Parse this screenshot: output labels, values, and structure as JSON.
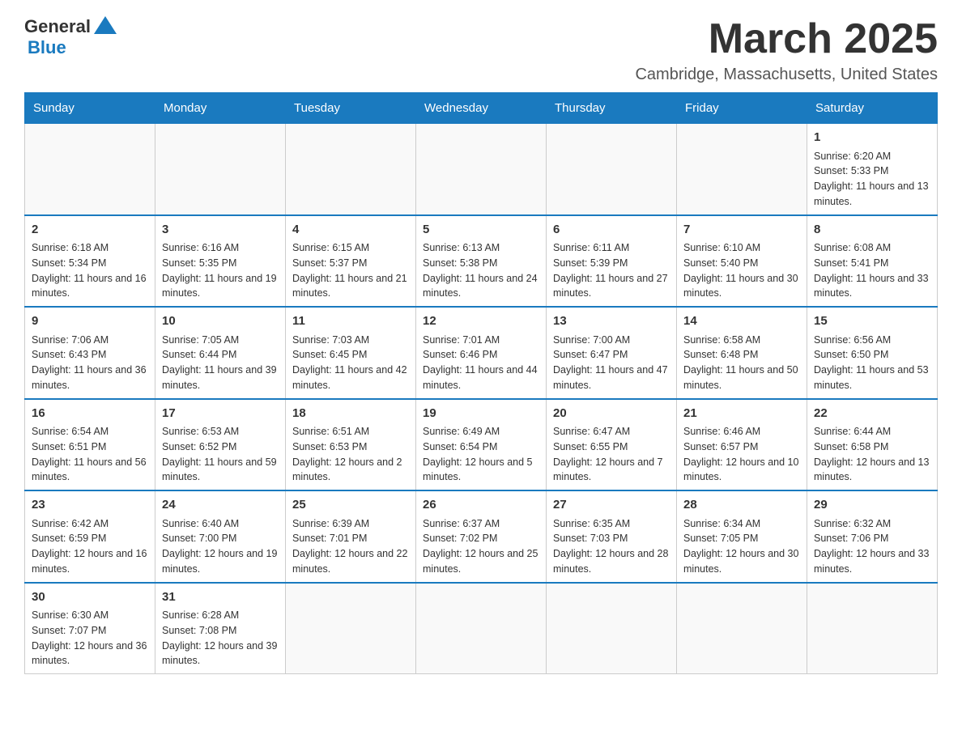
{
  "logo": {
    "general": "General",
    "blue": "Blue"
  },
  "title": "March 2025",
  "subtitle": "Cambridge, Massachusetts, United States",
  "days_of_week": [
    "Sunday",
    "Monday",
    "Tuesday",
    "Wednesday",
    "Thursday",
    "Friday",
    "Saturday"
  ],
  "weeks": [
    [
      {
        "day": "",
        "info": ""
      },
      {
        "day": "",
        "info": ""
      },
      {
        "day": "",
        "info": ""
      },
      {
        "day": "",
        "info": ""
      },
      {
        "day": "",
        "info": ""
      },
      {
        "day": "",
        "info": ""
      },
      {
        "day": "1",
        "info": "Sunrise: 6:20 AM\nSunset: 5:33 PM\nDaylight: 11 hours and 13 minutes."
      }
    ],
    [
      {
        "day": "2",
        "info": "Sunrise: 6:18 AM\nSunset: 5:34 PM\nDaylight: 11 hours and 16 minutes."
      },
      {
        "day": "3",
        "info": "Sunrise: 6:16 AM\nSunset: 5:35 PM\nDaylight: 11 hours and 19 minutes."
      },
      {
        "day": "4",
        "info": "Sunrise: 6:15 AM\nSunset: 5:37 PM\nDaylight: 11 hours and 21 minutes."
      },
      {
        "day": "5",
        "info": "Sunrise: 6:13 AM\nSunset: 5:38 PM\nDaylight: 11 hours and 24 minutes."
      },
      {
        "day": "6",
        "info": "Sunrise: 6:11 AM\nSunset: 5:39 PM\nDaylight: 11 hours and 27 minutes."
      },
      {
        "day": "7",
        "info": "Sunrise: 6:10 AM\nSunset: 5:40 PM\nDaylight: 11 hours and 30 minutes."
      },
      {
        "day": "8",
        "info": "Sunrise: 6:08 AM\nSunset: 5:41 PM\nDaylight: 11 hours and 33 minutes."
      }
    ],
    [
      {
        "day": "9",
        "info": "Sunrise: 7:06 AM\nSunset: 6:43 PM\nDaylight: 11 hours and 36 minutes."
      },
      {
        "day": "10",
        "info": "Sunrise: 7:05 AM\nSunset: 6:44 PM\nDaylight: 11 hours and 39 minutes."
      },
      {
        "day": "11",
        "info": "Sunrise: 7:03 AM\nSunset: 6:45 PM\nDaylight: 11 hours and 42 minutes."
      },
      {
        "day": "12",
        "info": "Sunrise: 7:01 AM\nSunset: 6:46 PM\nDaylight: 11 hours and 44 minutes."
      },
      {
        "day": "13",
        "info": "Sunrise: 7:00 AM\nSunset: 6:47 PM\nDaylight: 11 hours and 47 minutes."
      },
      {
        "day": "14",
        "info": "Sunrise: 6:58 AM\nSunset: 6:48 PM\nDaylight: 11 hours and 50 minutes."
      },
      {
        "day": "15",
        "info": "Sunrise: 6:56 AM\nSunset: 6:50 PM\nDaylight: 11 hours and 53 minutes."
      }
    ],
    [
      {
        "day": "16",
        "info": "Sunrise: 6:54 AM\nSunset: 6:51 PM\nDaylight: 11 hours and 56 minutes."
      },
      {
        "day": "17",
        "info": "Sunrise: 6:53 AM\nSunset: 6:52 PM\nDaylight: 11 hours and 59 minutes."
      },
      {
        "day": "18",
        "info": "Sunrise: 6:51 AM\nSunset: 6:53 PM\nDaylight: 12 hours and 2 minutes."
      },
      {
        "day": "19",
        "info": "Sunrise: 6:49 AM\nSunset: 6:54 PM\nDaylight: 12 hours and 5 minutes."
      },
      {
        "day": "20",
        "info": "Sunrise: 6:47 AM\nSunset: 6:55 PM\nDaylight: 12 hours and 7 minutes."
      },
      {
        "day": "21",
        "info": "Sunrise: 6:46 AM\nSunset: 6:57 PM\nDaylight: 12 hours and 10 minutes."
      },
      {
        "day": "22",
        "info": "Sunrise: 6:44 AM\nSunset: 6:58 PM\nDaylight: 12 hours and 13 minutes."
      }
    ],
    [
      {
        "day": "23",
        "info": "Sunrise: 6:42 AM\nSunset: 6:59 PM\nDaylight: 12 hours and 16 minutes."
      },
      {
        "day": "24",
        "info": "Sunrise: 6:40 AM\nSunset: 7:00 PM\nDaylight: 12 hours and 19 minutes."
      },
      {
        "day": "25",
        "info": "Sunrise: 6:39 AM\nSunset: 7:01 PM\nDaylight: 12 hours and 22 minutes."
      },
      {
        "day": "26",
        "info": "Sunrise: 6:37 AM\nSunset: 7:02 PM\nDaylight: 12 hours and 25 minutes."
      },
      {
        "day": "27",
        "info": "Sunrise: 6:35 AM\nSunset: 7:03 PM\nDaylight: 12 hours and 28 minutes."
      },
      {
        "day": "28",
        "info": "Sunrise: 6:34 AM\nSunset: 7:05 PM\nDaylight: 12 hours and 30 minutes."
      },
      {
        "day": "29",
        "info": "Sunrise: 6:32 AM\nSunset: 7:06 PM\nDaylight: 12 hours and 33 minutes."
      }
    ],
    [
      {
        "day": "30",
        "info": "Sunrise: 6:30 AM\nSunset: 7:07 PM\nDaylight: 12 hours and 36 minutes."
      },
      {
        "day": "31",
        "info": "Sunrise: 6:28 AM\nSunset: 7:08 PM\nDaylight: 12 hours and 39 minutes."
      },
      {
        "day": "",
        "info": ""
      },
      {
        "day": "",
        "info": ""
      },
      {
        "day": "",
        "info": ""
      },
      {
        "day": "",
        "info": ""
      },
      {
        "day": "",
        "info": ""
      }
    ]
  ]
}
